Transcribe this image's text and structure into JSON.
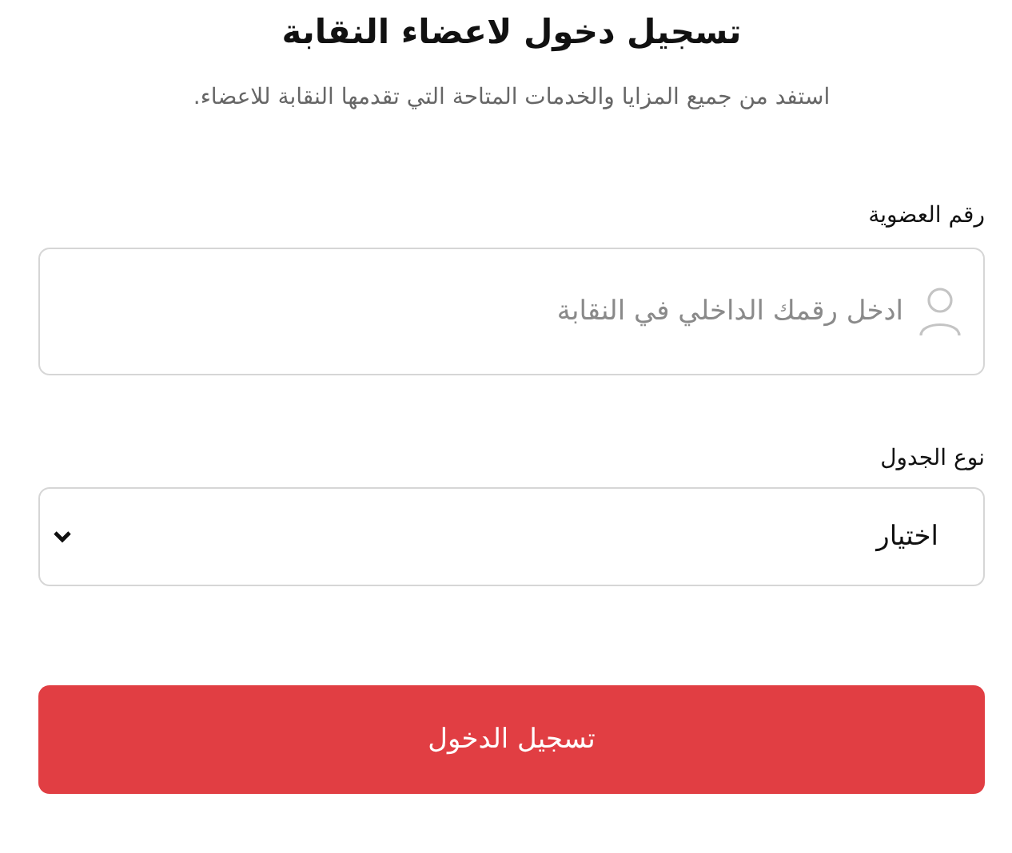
{
  "title": "تسجيل دخول لاعضاء النقابة",
  "subtitle": "استفد من جميع المزايا والخدمات المتاحة التي تقدمها النقابة للاعضاء.",
  "membership_field": {
    "label": "رقم العضوية",
    "placeholder": "ادخل رقمك الداخلي في النقابة"
  },
  "table_type_field": {
    "label": "نوع الجدول",
    "value": "اختيار"
  },
  "submit_button": "تسجيل الدخول"
}
